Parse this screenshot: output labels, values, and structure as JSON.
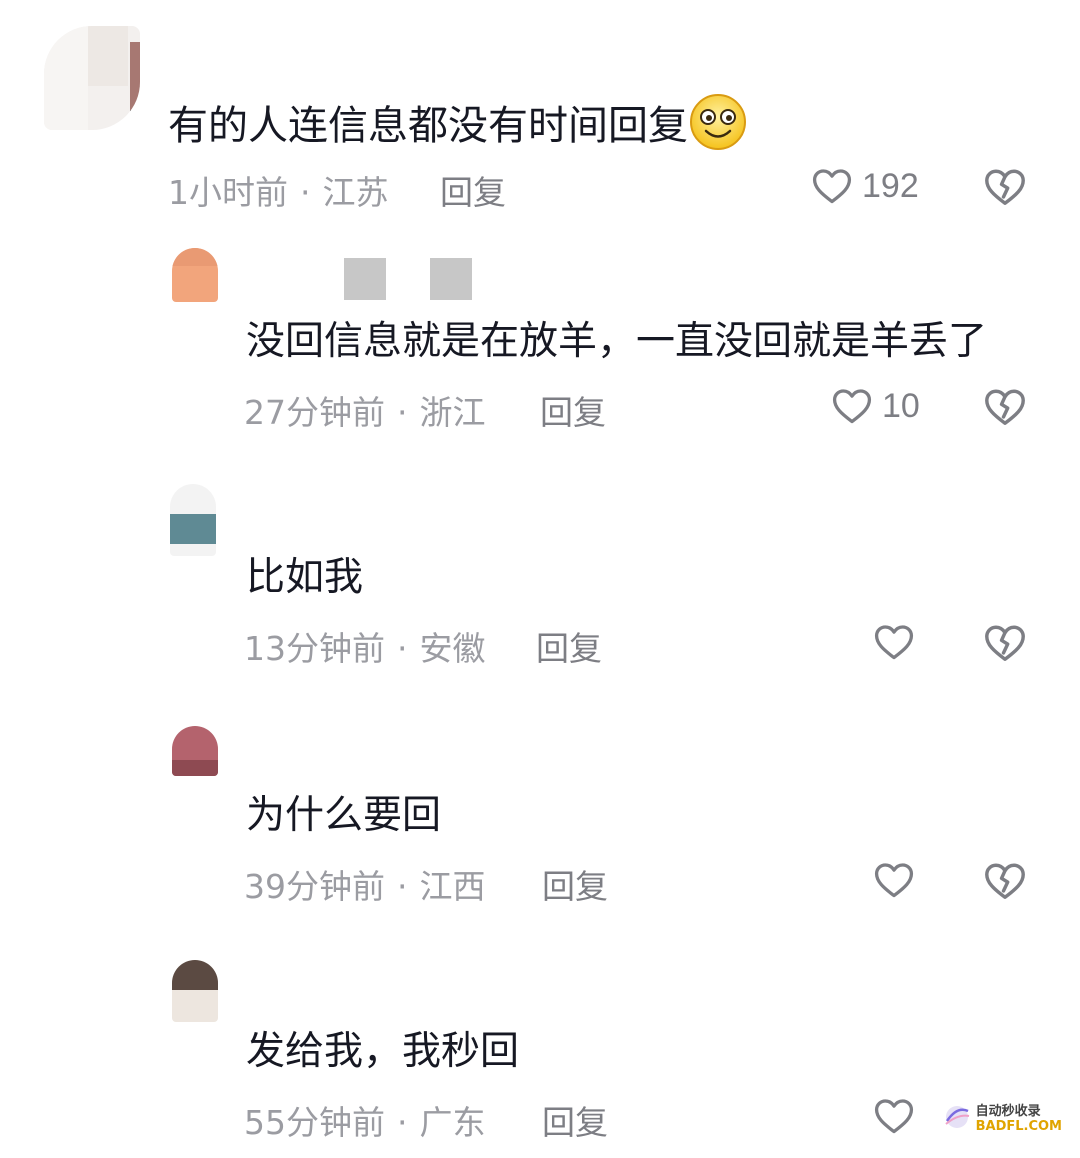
{
  "comments": [
    {
      "text": "有的人连信息都没有时间回复",
      "emoji_icon": "smiling-face-emoji",
      "time": "1小时前",
      "location": "江苏",
      "reply_label": "回复",
      "likes": "192"
    },
    {
      "text": "没回信息就是在放羊，一直没回就是羊丢了",
      "time": "27分钟前",
      "location": "浙江",
      "reply_label": "回复",
      "likes": "10"
    },
    {
      "text": "比如我",
      "time": "13分钟前",
      "location": "安徽",
      "reply_label": "回复",
      "likes": ""
    },
    {
      "text": "为什么要回",
      "time": "39分钟前",
      "location": "江西",
      "reply_label": "回复",
      "likes": ""
    },
    {
      "text": "发给我，我秒回",
      "time": "55分钟前",
      "location": "广东",
      "reply_label": "回复",
      "likes": ""
    }
  ],
  "separator": "·",
  "icons": {
    "like": "heart-outline-icon",
    "dislike": "broken-heart-icon"
  },
  "colors": {
    "text": "#161823",
    "meta": "#9b9ca2",
    "icon": "#7d7e84"
  },
  "watermark": {
    "line1": "自动秒收录",
    "line2": "BADFL.COM"
  }
}
